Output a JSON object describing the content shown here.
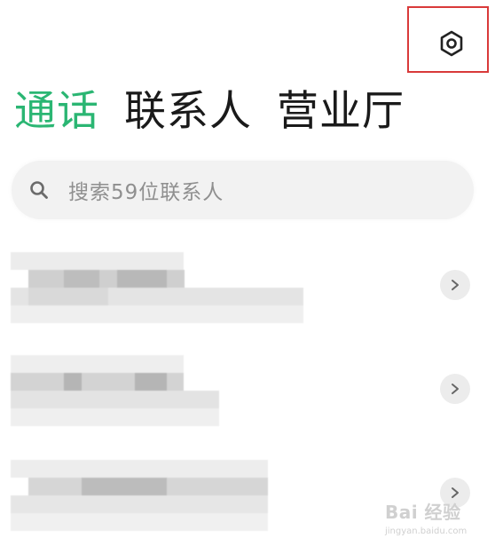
{
  "colors": {
    "accent": "#2bb673",
    "highlight_border": "#d93a3a"
  },
  "header": {
    "settings_icon": "hexagon-settings-icon"
  },
  "tabs": [
    {
      "label": "通话",
      "active": true
    },
    {
      "label": "联系人",
      "active": false
    },
    {
      "label": "营业厅",
      "active": false
    }
  ],
  "search": {
    "placeholder": "搜索59位联系人",
    "icon": "search-icon"
  },
  "contacts": [
    {
      "name": "",
      "detail": "",
      "pixelated": true,
      "action_icon": "chevron-right-icon"
    },
    {
      "name": "",
      "detail": "",
      "pixelated": true,
      "action_icon": "chevron-right-icon"
    },
    {
      "name": "",
      "detail": "",
      "pixelated": true,
      "action_icon": "chevron-right-icon"
    }
  ],
  "watermark": {
    "main": "Bai 经验",
    "sub": "jingyan.baidu.com"
  }
}
